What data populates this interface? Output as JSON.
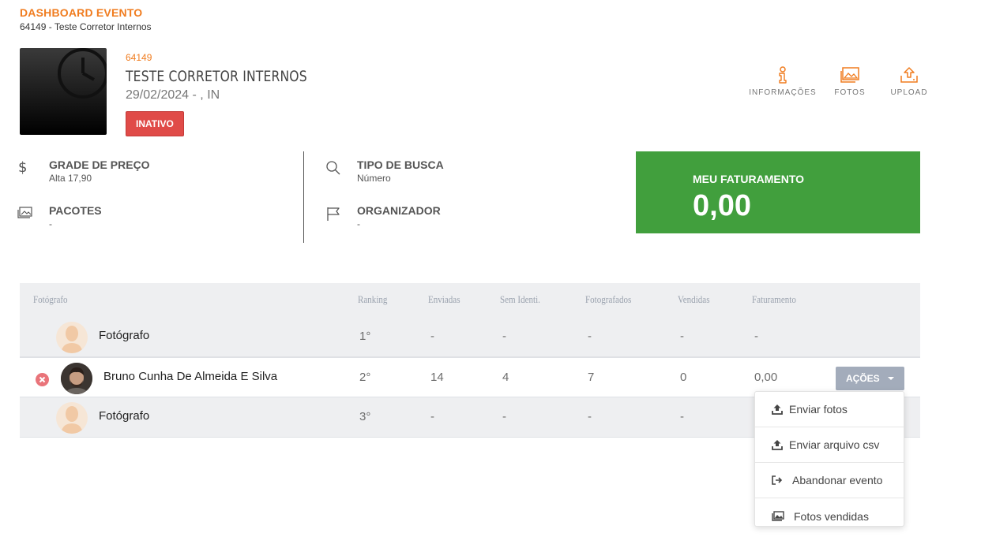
{
  "header": {
    "title": "DASHBOARD EVENTO",
    "subtitle": "64149 - Teste Corretor Internos"
  },
  "event": {
    "code": "64149",
    "name": "TESTE CORRETOR INTERNOS",
    "date": "29/02/2024 - , IN",
    "status": "INATIVO"
  },
  "top_actions": [
    {
      "label": "INFORMAÇÕES",
      "icon": "info-icon"
    },
    {
      "label": "FOTOS",
      "icon": "photos-icon"
    },
    {
      "label": "UPLOAD",
      "icon": "upload-icon"
    }
  ],
  "info": {
    "grade": {
      "title": "GRADE DE PREÇO",
      "value": "Alta 17,90",
      "icon": "dollar-icon"
    },
    "pacotes": {
      "title": "PACOTES",
      "value": "-",
      "icon": "photos-icon"
    },
    "busca": {
      "title": "TIPO DE BUSCA",
      "value": "Número",
      "icon": "search-icon"
    },
    "organizador": {
      "title": "ORGANIZADOR",
      "value": "-",
      "icon": "flag-icon"
    }
  },
  "revenue": {
    "label": "MEU FATURAMENTO",
    "value": "0,00"
  },
  "colors": {
    "accent": "#f07c1f",
    "inactive": "#e04b48",
    "revenue_bg": "#419f3d",
    "actions_btn": "#a3acbb"
  },
  "table": {
    "headers": [
      "Fotógrafo",
      "Ranking",
      "Enviadas",
      "Sem Identi.",
      "Fotografados",
      "Vendidas",
      "Faturamento"
    ],
    "rows": [
      {
        "name": "Fotógrafo",
        "ranking": "1°",
        "enviadas": "-",
        "sem_identi": "-",
        "fotografados": "-",
        "vendidas": "-",
        "faturamento": "-"
      },
      {
        "name": "Bruno Cunha De Almeida E Silva",
        "ranking": "2°",
        "enviadas": "14",
        "sem_identi": "4",
        "fotografados": "7",
        "vendidas": "0",
        "faturamento": "0,00"
      },
      {
        "name": "Fotógrafo",
        "ranking": "3°",
        "enviadas": "-",
        "sem_identi": "-",
        "fotografados": "-",
        "vendidas": "-",
        "faturamento": ""
      }
    ],
    "actions_label": "AÇÕES"
  },
  "dropdown": {
    "items": [
      {
        "label": "Enviar fotos",
        "icon": "upload-icon"
      },
      {
        "label": "Enviar arquivo csv",
        "icon": "upload-icon"
      },
      {
        "label": "Abandonar evento",
        "icon": "sign-out-icon"
      },
      {
        "label": "Fotos vendidas",
        "icon": "photos-icon"
      }
    ]
  }
}
